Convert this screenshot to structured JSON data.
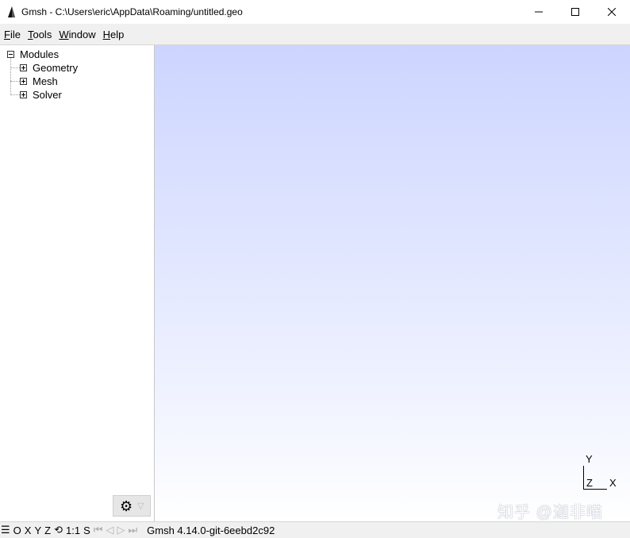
{
  "window": {
    "title": "Gmsh - C:\\Users\\eric\\AppData\\Roaming/untitled.geo"
  },
  "menu": {
    "items": [
      {
        "mnemonic": "F",
        "rest": "ile"
      },
      {
        "mnemonic": "T",
        "rest": "ools"
      },
      {
        "mnemonic": "W",
        "rest": "indow"
      },
      {
        "mnemonic": "H",
        "rest": "elp"
      }
    ]
  },
  "tree": {
    "root": "Modules",
    "children": [
      "Geometry",
      "Mesh",
      "Solver"
    ]
  },
  "axes": {
    "x": "X",
    "y": "Y",
    "z": "Z"
  },
  "watermark": "知乎 @迦非喵",
  "status": {
    "buttons": [
      "O",
      "X",
      "Y",
      "Z",
      "1:1",
      "S"
    ],
    "message": "Gmsh 4.14.0-git-6eebd2c92"
  },
  "icons": {
    "app": "gmsh-icon",
    "gear": "gear-icon",
    "menu": "hamburger-icon",
    "rotate": "rotate-icon"
  }
}
